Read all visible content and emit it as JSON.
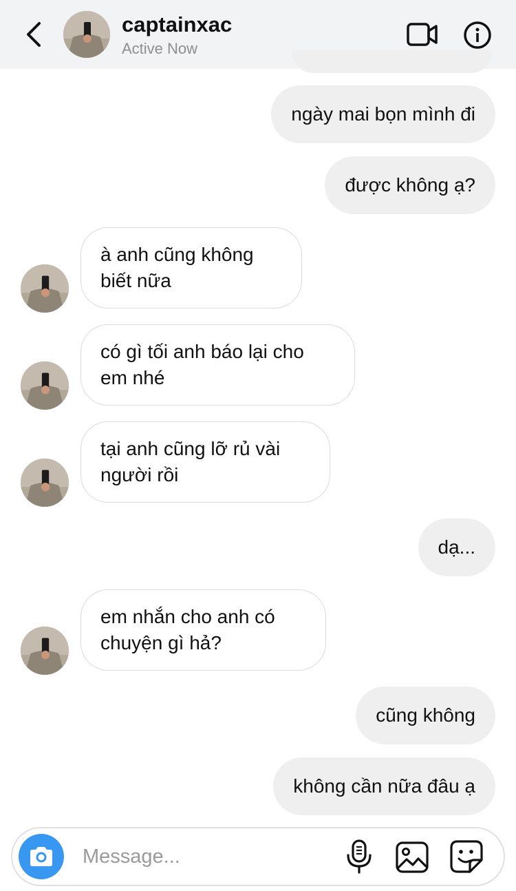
{
  "header": {
    "username": "captainxac",
    "status": "Active Now"
  },
  "messages": [
    {
      "side": "outgoing",
      "text": "ngày mai bọn mình đi"
    },
    {
      "side": "outgoing",
      "text": "được không ạ?"
    },
    {
      "side": "incoming",
      "text": "à anh cũng không biết nữa"
    },
    {
      "side": "incoming",
      "text": "có gì tối anh báo lại cho em nhé"
    },
    {
      "side": "incoming",
      "text": "tại anh cũng lỡ rủ vài người rồi"
    },
    {
      "side": "outgoing",
      "text": "dạ..."
    },
    {
      "side": "incoming",
      "text": "em nhắn cho anh có chuyện gì hả?"
    },
    {
      "side": "outgoing",
      "text": "cũng không"
    },
    {
      "side": "outgoing",
      "text": "không cần nữa đâu ạ"
    }
  ],
  "composer": {
    "placeholder": "Message..."
  },
  "icons": {
    "back": "chevron-left-icon",
    "video": "video-camera-icon",
    "info": "info-icon",
    "camera": "camera-icon",
    "mic": "microphone-icon",
    "gallery": "image-gallery-icon",
    "sticker": "sticker-icon"
  },
  "colors": {
    "header_bg": "#f2f3f5",
    "outgoing_bubble": "#efefef",
    "incoming_border": "#dbdbdb",
    "camera_button": "#3897f0",
    "status_text": "#8e8e8e"
  }
}
